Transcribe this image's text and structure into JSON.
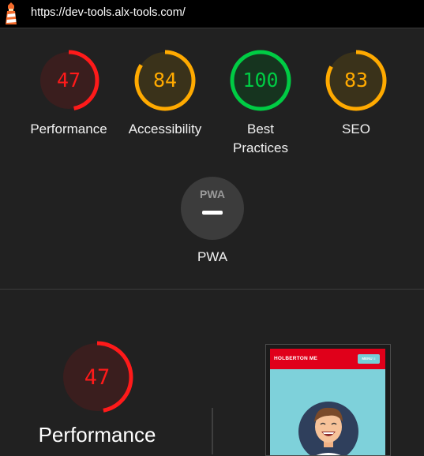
{
  "browser": {
    "url": "https://dev-tools.alx-tools.com/"
  },
  "gauges": [
    {
      "label": "Performance",
      "score": "47",
      "value": 0.47,
      "color": "#ff1a1a",
      "track": "#3a1e1e"
    },
    {
      "label": "Accessibility",
      "score": "84",
      "value": 0.84,
      "color": "#ffaa00",
      "track": "#3a321a"
    },
    {
      "label_line1": "Best",
      "label_line2": "Practices",
      "score": "100",
      "value": 1.0,
      "color": "#00cc44",
      "track": "#16341f"
    },
    {
      "label": "SEO",
      "score": "83",
      "value": 0.83,
      "color": "#ffaa00",
      "track": "#3a321a"
    }
  ],
  "pwa": {
    "badge_text": "PWA",
    "label": "PWA",
    "color": "#3c3c3c"
  },
  "detail": {
    "score": "47",
    "value": 0.47,
    "label": "Performance",
    "color": "#ff1a1a",
    "track": "#3a1e1e"
  },
  "preview": {
    "brand": "HOLBERTON ME",
    "menu": "MENU ≡",
    "header_color": "#e0001a",
    "bg_color": "#7ed1da"
  }
}
